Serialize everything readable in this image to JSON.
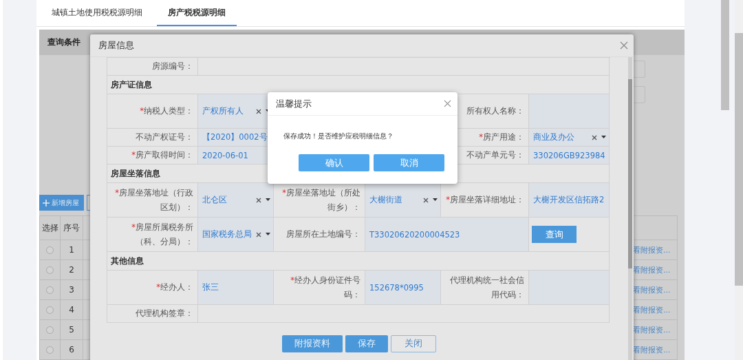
{
  "tabs": [
    {
      "label": "城镇土地使用税税源明细",
      "selected": false
    },
    {
      "label": "房产税税源明细",
      "selected": true
    }
  ],
  "query_panel": {
    "title": "查询条件"
  },
  "add_button": {
    "label": "新增房屋"
  },
  "table": {
    "columns": [
      "选择",
      "序号"
    ],
    "rows": [
      {
        "selected": false,
        "number": "1",
        "link": "看附报资..."
      },
      {
        "selected": false,
        "number": "2",
        "link": "看附报资..."
      },
      {
        "selected": false,
        "number": "3",
        "link": "看附报资..."
      },
      {
        "selected": false,
        "number": "4",
        "link": "看附报资..."
      },
      {
        "selected": false,
        "number": "5",
        "link": "看附报资..."
      },
      {
        "selected": false,
        "number": "6",
        "link": "看附报资..."
      }
    ]
  },
  "modal": {
    "title": "房屋信息",
    "rows": [
      {
        "kind": "single",
        "label": "房源编号："
      },
      {
        "kind": "section",
        "title": "房产证信息"
      },
      {
        "kind": "tall",
        "cells": [
          {
            "kind": "label",
            "mark": "*",
            "text": "纳税人类型："
          },
          {
            "kind": "select",
            "value": "产权所有人"
          },
          {
            "kind": "label",
            "text": "所有权人名称："
          },
          {
            "kind": "input"
          }
        ]
      },
      {
        "kind": "short",
        "cells": [
          {
            "kind": "label",
            "text": "不动产权证号："
          },
          {
            "kind": "input",
            "value": "【2020】0002号"
          },
          {
            "kind": "label",
            "mark": "*",
            "text": "房产用途："
          },
          {
            "kind": "select",
            "value": "商业及办公"
          }
        ]
      },
      {
        "kind": "short",
        "cells": [
          {
            "kind": "label",
            "mark": "*",
            "text": "房产取得时间："
          },
          {
            "kind": "date",
            "value": "2020-06-01"
          },
          {
            "kind": "label",
            "text": "不动产单元号："
          },
          {
            "kind": "input",
            "value": "330206GB923984"
          }
        ]
      },
      {
        "kind": "section",
        "title": "房屋坐落信息"
      },
      {
        "kind": "tall",
        "cells": [
          {
            "kind": "label",
            "mark": "*",
            "text": "房屋坐落地址（行政区划）："
          },
          {
            "kind": "select",
            "value": "北仑区"
          },
          {
            "kind": "label",
            "mark": "*",
            "text": "房屋坐落地址（所处街乡）："
          },
          {
            "kind": "select",
            "value": "大榭街道"
          },
          {
            "kind": "label",
            "mark": "*",
            "text": "房屋坐落详细地址："
          },
          {
            "kind": "input",
            "value": "大榭开发区信拓路2"
          }
        ]
      },
      {
        "kind": "tall",
        "cells": [
          {
            "kind": "label",
            "mark": "*",
            "text": "房屋所属税务所（科、分局）："
          },
          {
            "kind": "select",
            "value": "国家税务总局"
          },
          {
            "kind": "label",
            "text": "房屋所在土地编号："
          },
          {
            "kind": "wide_input",
            "value": "T33020620200004523"
          },
          {
            "kind": "button",
            "text": "查询"
          }
        ]
      },
      {
        "kind": "section",
        "title": "其他信息"
      },
      {
        "kind": "tall",
        "cells": [
          {
            "kind": "label",
            "mark": "*",
            "text": "经办人："
          },
          {
            "kind": "input",
            "value": "张三"
          },
          {
            "kind": "label",
            "mark": "*",
            "text": "经办人身份证件号码："
          },
          {
            "kind": "input",
            "value": "152678*0995"
          },
          {
            "kind": "label",
            "text": "代理机构统一社会信用代码："
          },
          {
            "kind": "input"
          }
        ]
      },
      {
        "kind": "single",
        "label": "代理机构签章："
      }
    ],
    "buttons": [
      {
        "label": "附报资料",
        "kind": "primary"
      },
      {
        "label": "保存",
        "kind": "primary"
      },
      {
        "label": "关闭",
        "kind": "outline"
      }
    ]
  },
  "dialog": {
    "title": "温馨提示",
    "message": "保存成功！是否维护应税明细信息？",
    "buttons": [
      "确认",
      "取消"
    ]
  }
}
